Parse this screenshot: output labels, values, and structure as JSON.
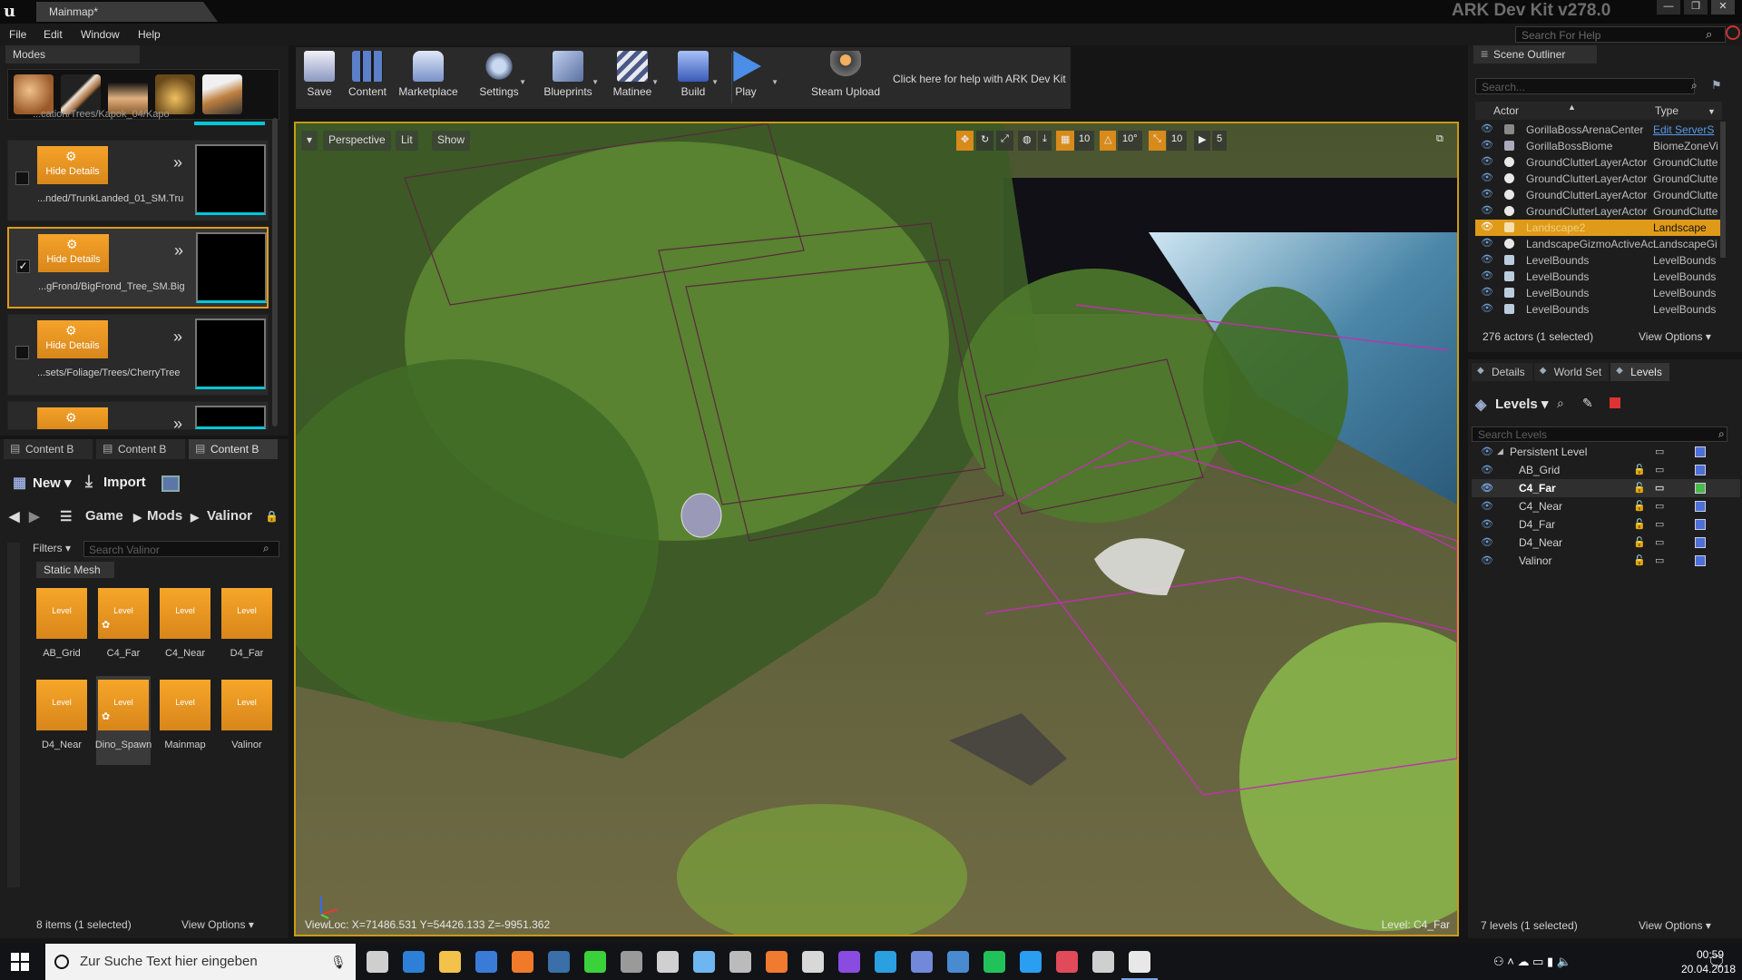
{
  "window": {
    "tab_title": "Mainmap*",
    "app_title": "ARK Dev Kit v278.0",
    "logo_text": "u",
    "controls": [
      "—",
      "❐",
      "✕"
    ]
  },
  "menu": {
    "items": [
      "File",
      "Edit",
      "Window",
      "Help"
    ],
    "search_placeholder": "Search For Help"
  },
  "modes": {
    "tab_label": "Modes",
    "tool_icons": [
      "place-icon",
      "paint-icon",
      "landscape-icon",
      "foliage-icon",
      "geometry-icon"
    ],
    "rows": [
      {
        "button": "Hide Details",
        "path": "...nded/TrunkLanded_01_SM.Tru",
        "checked": false,
        "selected": false
      },
      {
        "button": "Hide Details",
        "path": "...gFrond/BigFrond_Tree_SM.Big",
        "checked": true,
        "selected": true
      },
      {
        "button": "Hide Details",
        "path": "...sets/Foliage/Trees/CherryTree",
        "checked": false,
        "selected": false
      }
    ],
    "top_partial_path": "...cation/Trees/Kapok_04/Kapo",
    "check_mark": "✓",
    "chevron": "»"
  },
  "content_browser": {
    "tabs": [
      "Content B",
      "Content B",
      "Content B"
    ],
    "new_label": "New ▾",
    "import_label": "Import",
    "breadcrumb": [
      "Game",
      "Mods",
      "Valinor"
    ],
    "filters_label": "Filters ▾",
    "search_placeholder": "Search Valinor",
    "filter_chip": "Static Mesh",
    "assets": [
      {
        "name": "AB_Grid",
        "kind": "Level",
        "starred": false
      },
      {
        "name": "C4_Far",
        "kind": "Level",
        "starred": true
      },
      {
        "name": "C4_Near",
        "kind": "Level",
        "starred": false
      },
      {
        "name": "D4_Far",
        "kind": "Level",
        "starred": false
      },
      {
        "name": "D4_Near",
        "kind": "Level",
        "starred": false
      },
      {
        "name": "Dino_Spawn",
        "kind": "Level",
        "starred": true,
        "selected": true
      },
      {
        "name": "Mainmap",
        "kind": "Level",
        "starred": false
      },
      {
        "name": "Valinor",
        "kind": "Level",
        "starred": false
      }
    ],
    "status": "8 items (1 selected)",
    "view_options": "View Options ▾"
  },
  "toolbar": {
    "buttons": [
      {
        "label": "Save",
        "icon": "save-icon",
        "color": "#d8d8e8",
        "dropdown": false
      },
      {
        "label": "Content",
        "icon": "content-icon",
        "color": "#5b7fc8",
        "dropdown": false
      },
      {
        "label": "Marketplace",
        "icon": "marketplace-icon",
        "color": "#9fb6e0",
        "dropdown": false
      },
      {
        "label": "Settings",
        "icon": "settings-icon",
        "color": "#8ea6c8",
        "dropdown": true
      },
      {
        "label": "Blueprints",
        "icon": "blueprints-icon",
        "color": "#7d98c0",
        "dropdown": true
      },
      {
        "label": "Matinee",
        "icon": "matinee-icon",
        "color": "#c8c8d8",
        "dropdown": true
      },
      {
        "label": "Build",
        "icon": "build-icon",
        "color": "#6d8ee0",
        "dropdown": true
      },
      {
        "label": "Play",
        "icon": "play-icon",
        "color": "#4a8ee8",
        "dropdown": true
      },
      {
        "label": "Steam Upload",
        "icon": "steam-upload-icon",
        "color": "#e0a050",
        "dropdown": false
      }
    ],
    "help_link": "Click here for help with ARK Dev Kit"
  },
  "viewport": {
    "menu_glyph": "▾",
    "perspective_label": "Perspective",
    "lit_label": "Lit",
    "show_label": "Show",
    "grid_snap": "10",
    "rotation_snap": "10°",
    "scale_snap": "10",
    "camera_speed": "5",
    "maximize_glyph": "⧉",
    "viewloc": "ViewLoc: X=71486.531 Y=54426.133 Z=-9951.362",
    "level_text": "Level:  C4_Far"
  },
  "outliner": {
    "tab_label": "Scene Outliner",
    "search_placeholder": "Search...",
    "col_actor": "Actor",
    "col_type": "Type",
    "rows": [
      {
        "actor": "GorillaBossArenaCenter",
        "type": "Edit ServerS",
        "type_link": true
      },
      {
        "actor": "GorillaBossBiome",
        "type": "BiomeZoneVi"
      },
      {
        "actor": "GroundClutterLayerActor",
        "type": "GroundClutte"
      },
      {
        "actor": "GroundClutterLayerActor",
        "type": "GroundClutte"
      },
      {
        "actor": "GroundClutterLayerActor",
        "type": "GroundClutte"
      },
      {
        "actor": "GroundClutterLayerActor",
        "type": "GroundClutte"
      },
      {
        "actor": "Landscape2",
        "type": "Landscape",
        "selected": true
      },
      {
        "actor": "LandscapeGizmoActiveActor",
        "type": "LandscapeGi"
      },
      {
        "actor": "LevelBounds",
        "type": "LevelBounds"
      },
      {
        "actor": "LevelBounds",
        "type": "LevelBounds"
      },
      {
        "actor": "LevelBounds",
        "type": "LevelBounds"
      },
      {
        "actor": "LevelBounds",
        "type": "LevelBounds"
      }
    ],
    "status": "276 actors (1 selected)",
    "view_options": "View Options ▾"
  },
  "right_tabs": [
    "Details",
    "World Set",
    "Levels"
  ],
  "levels": {
    "menu_label": "Levels ▾",
    "search_placeholder": "Search Levels",
    "rows": [
      {
        "name": "Persistent Level",
        "indent": 0,
        "expand": "◢",
        "lock": false,
        "save": true
      },
      {
        "name": "AB_Grid",
        "indent": 1,
        "lock": true,
        "save": true
      },
      {
        "name": "C4_Far",
        "indent": 1,
        "lock": true,
        "save": true,
        "selected": true,
        "save_green": true
      },
      {
        "name": "C4_Near",
        "indent": 1,
        "lock": true,
        "save": true
      },
      {
        "name": "D4_Far",
        "indent": 1,
        "lock": true,
        "save": true
      },
      {
        "name": "D4_Near",
        "indent": 1,
        "lock": true,
        "save": true
      },
      {
        "name": "Valinor",
        "indent": 1,
        "lock": true,
        "save": true
      }
    ],
    "status": "7 levels (1 selected)",
    "view_options": "View Options ▾"
  },
  "taskbar": {
    "search_text": "Zur Suche Text hier eingeben",
    "apps": [
      {
        "icon": "task-view-icon",
        "color": "#cfcfcf"
      },
      {
        "icon": "edge-icon",
        "color": "#2d7fd8"
      },
      {
        "icon": "explorer-icon",
        "color": "#f2c24a"
      },
      {
        "icon": "store-icon",
        "color": "#3b7bd8"
      },
      {
        "icon": "firefox-icon",
        "color": "#f07a2a"
      },
      {
        "icon": "steam-icon",
        "color": "#3a6fa8"
      },
      {
        "icon": "razer-icon",
        "color": "#3bd13b"
      },
      {
        "icon": "game-icon",
        "color": "#9a9a9a"
      },
      {
        "icon": "obs-icon",
        "color": "#d0d0d0"
      },
      {
        "icon": "maps-icon",
        "color": "#6fb6f0"
      },
      {
        "icon": "app-icon",
        "color": "#bbbbbb"
      },
      {
        "icon": "origin-icon",
        "color": "#f07a30"
      },
      {
        "icon": "ark-icon",
        "color": "#d8d8d8"
      },
      {
        "icon": "twitch-icon",
        "color": "#8a4ce0"
      },
      {
        "icon": "adobe-icon",
        "color": "#2aa0e0"
      },
      {
        "icon": "discord-icon",
        "color": "#7289da"
      },
      {
        "icon": "monitor-icon",
        "color": "#4a8ad0"
      },
      {
        "icon": "xbox-icon",
        "color": "#22c25a"
      },
      {
        "icon": "g-icon",
        "color": "#2a9ef0"
      },
      {
        "icon": "teams-icon",
        "color": "#e04a5a"
      },
      {
        "icon": "epic-icon",
        "color": "#cfcfcf"
      },
      {
        "icon": "unreal-icon",
        "color": "#e8e8e8"
      }
    ],
    "tray_icons": "⚇ ˄ ☁ ▭ ▮ 🔈",
    "time": "00:59",
    "date": "20.04.2018",
    "notify_glyph": "🗨"
  }
}
